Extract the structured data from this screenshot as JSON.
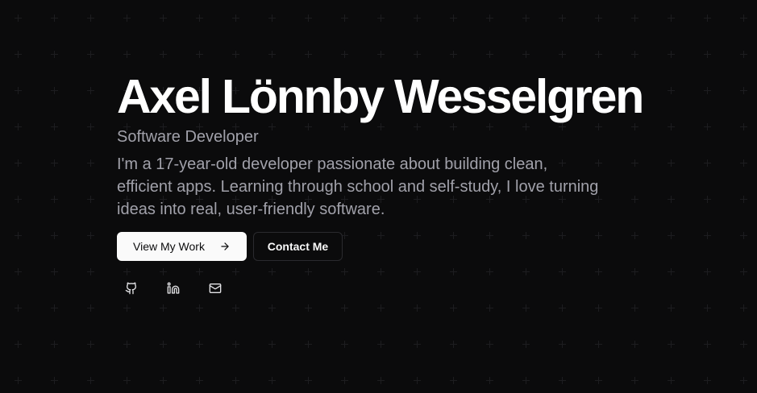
{
  "hero": {
    "name": "Axel Lönnby Wesselgren",
    "role": "Software Developer",
    "bio": "I'm a 17-year-old developer passionate about building clean, efficient apps. Learning through school and self-study, I love turning ideas into real, user-friendly software."
  },
  "actions": {
    "primary_label": "View My Work",
    "primary_icon": "arrow-right-icon",
    "secondary_label": "Contact Me"
  },
  "socials": [
    {
      "icon": "github-icon"
    },
    {
      "icon": "linkedin-icon"
    },
    {
      "icon": "mail-icon"
    }
  ],
  "colors": {
    "background": "#0b0b0c",
    "grid_plus": "#1d1d20",
    "text_primary": "#ffffff",
    "text_muted": "#a1a1aa",
    "button_primary_bg": "#fafafa",
    "button_secondary_border": "#2a2a2e"
  }
}
